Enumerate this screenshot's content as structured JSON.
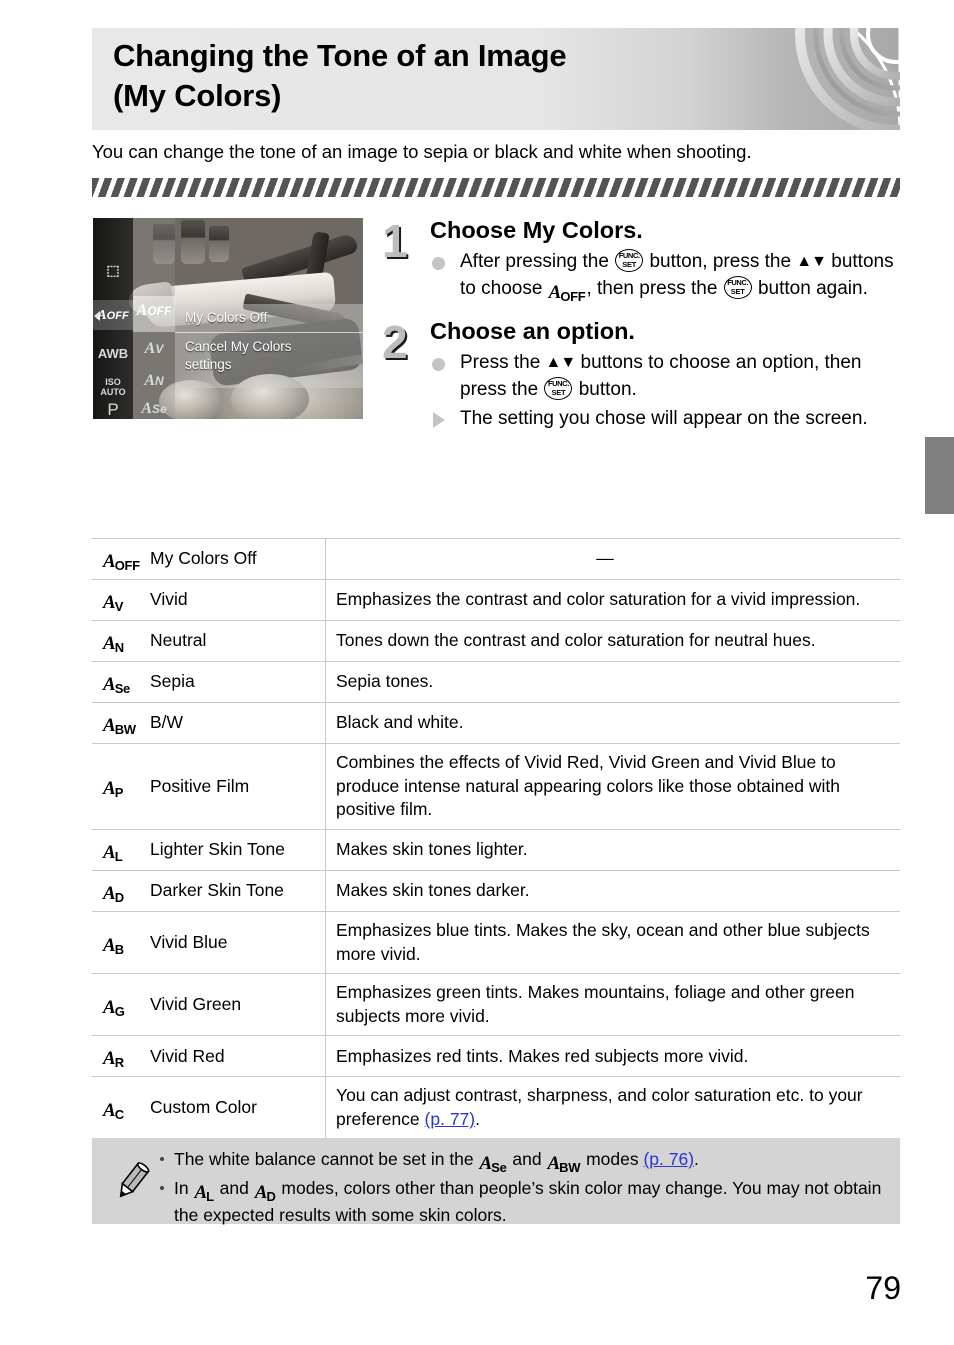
{
  "header": {
    "title": "Changing the Tone of an Image\n(My Colors)",
    "deco_icon": "lens-rings-decoration"
  },
  "intro": {
    "text": "You can change the tone of an image to sepia or black and white when shooting."
  },
  "screenshot": {
    "name": "camera-lcd-screenshot",
    "left_column_icons": [
      "metering-icon",
      "my-colors-off-icon",
      "AWB",
      "ISO AUTO",
      "P"
    ],
    "second_column_icons": [
      "OFF",
      "V",
      "N",
      "Se"
    ],
    "panel_title": "My Colors Off",
    "panel_text": "Cancel My Colors\nsettings"
  },
  "steps": [
    {
      "number": "1",
      "heading": "Choose My Colors.",
      "lines": [
        {
          "marker": "dot",
          "parts": [
            {
              "t": "text",
              "v": "After pressing the "
            },
            {
              "t": "funcset"
            },
            {
              "t": "text",
              "v": " button, press the "
            },
            {
              "t": "updown"
            },
            {
              "t": "text",
              "v": " buttons to choose "
            },
            {
              "t": "mycolors",
              "sub": "OFF"
            },
            {
              "t": "text",
              "v": ", then press the "
            },
            {
              "t": "funcset"
            },
            {
              "t": "text",
              "v": " button again."
            }
          ]
        }
      ]
    },
    {
      "number": "2",
      "heading": "Choose an option.",
      "lines": [
        {
          "marker": "dot",
          "parts": [
            {
              "t": "text",
              "v": "Press the "
            },
            {
              "t": "updown"
            },
            {
              "t": "text",
              "v": " buttons to choose an option, then press the "
            },
            {
              "t": "funcset"
            },
            {
              "t": "text",
              "v": " button."
            }
          ]
        },
        {
          "marker": "triangle",
          "parts": [
            {
              "t": "text",
              "v": "The setting you chose will appear on the screen."
            }
          ]
        }
      ]
    }
  ],
  "table": {
    "rows": [
      {
        "icon_sub": "OFF",
        "name": "My Colors Off",
        "desc": "—",
        "desc_dash": true
      },
      {
        "icon_sub": "V",
        "name": "Vivid",
        "desc": "Emphasizes the contrast and color saturation for a vivid impression."
      },
      {
        "icon_sub": "N",
        "name": "Neutral",
        "desc": "Tones down the contrast and color saturation for neutral hues."
      },
      {
        "icon_sub": "Se",
        "name": "Sepia",
        "desc": "Sepia tones."
      },
      {
        "icon_sub": "BW",
        "name": "B/W",
        "desc": "Black and white."
      },
      {
        "icon_sub": "P",
        "name": "Positive Film",
        "desc": "Combines the effects of Vivid Red, Vivid Green and Vivid Blue to produce intense natural appearing colors like those obtained with positive film."
      },
      {
        "icon_sub": "L",
        "name": "Lighter Skin Tone",
        "desc": "Makes skin tones lighter."
      },
      {
        "icon_sub": "D",
        "name": "Darker Skin Tone",
        "desc": "Makes skin tones darker."
      },
      {
        "icon_sub": "B",
        "name": "Vivid Blue",
        "desc": "Emphasizes blue tints. Makes the sky, ocean and other blue subjects more vivid."
      },
      {
        "icon_sub": "G",
        "name": "Vivid Green",
        "desc": "Emphasizes green tints. Makes mountains, foliage and other green subjects more vivid."
      },
      {
        "icon_sub": "R",
        "name": "Vivid Red",
        "desc": "Emphasizes red tints. Makes red subjects more vivid."
      },
      {
        "icon_sub": "C",
        "name": "Custom Color",
        "desc": "You can adjust contrast, sharpness, and color saturation etc. to your preference ",
        "link": "(p. 77)",
        "desc_tail": "."
      }
    ]
  },
  "note": {
    "icon": "pencil-icon",
    "items": [
      {
        "parts": [
          {
            "t": "text",
            "v": "The white balance cannot be set in the "
          },
          {
            "t": "mycolors",
            "sub": "Se"
          },
          {
            "t": "text",
            "v": " and "
          },
          {
            "t": "mycolors",
            "sub": "BW"
          },
          {
            "t": "text",
            "v": " modes "
          },
          {
            "t": "link",
            "v": "(p. 76)"
          },
          {
            "t": "text",
            "v": "."
          }
        ]
      },
      {
        "parts": [
          {
            "t": "text",
            "v": "In "
          },
          {
            "t": "mycolors",
            "sub": "L"
          },
          {
            "t": "text",
            "v": " and "
          },
          {
            "t": "mycolors",
            "sub": "D"
          },
          {
            "t": "text",
            "v": " modes, colors other than people’s skin color may change. You may not obtain the expected results with some skin colors."
          }
        ]
      }
    ]
  },
  "side_tab": {
    "name": "chapter-tab-marker",
    "color": "#808080"
  },
  "folio": {
    "page_number": "79"
  },
  "colors": {
    "link": "#2b35d4",
    "note_bg": "#d4d4d4",
    "stripe": "#545454",
    "rule": "#c9c9c9",
    "step_number": "#bdbdbd"
  }
}
